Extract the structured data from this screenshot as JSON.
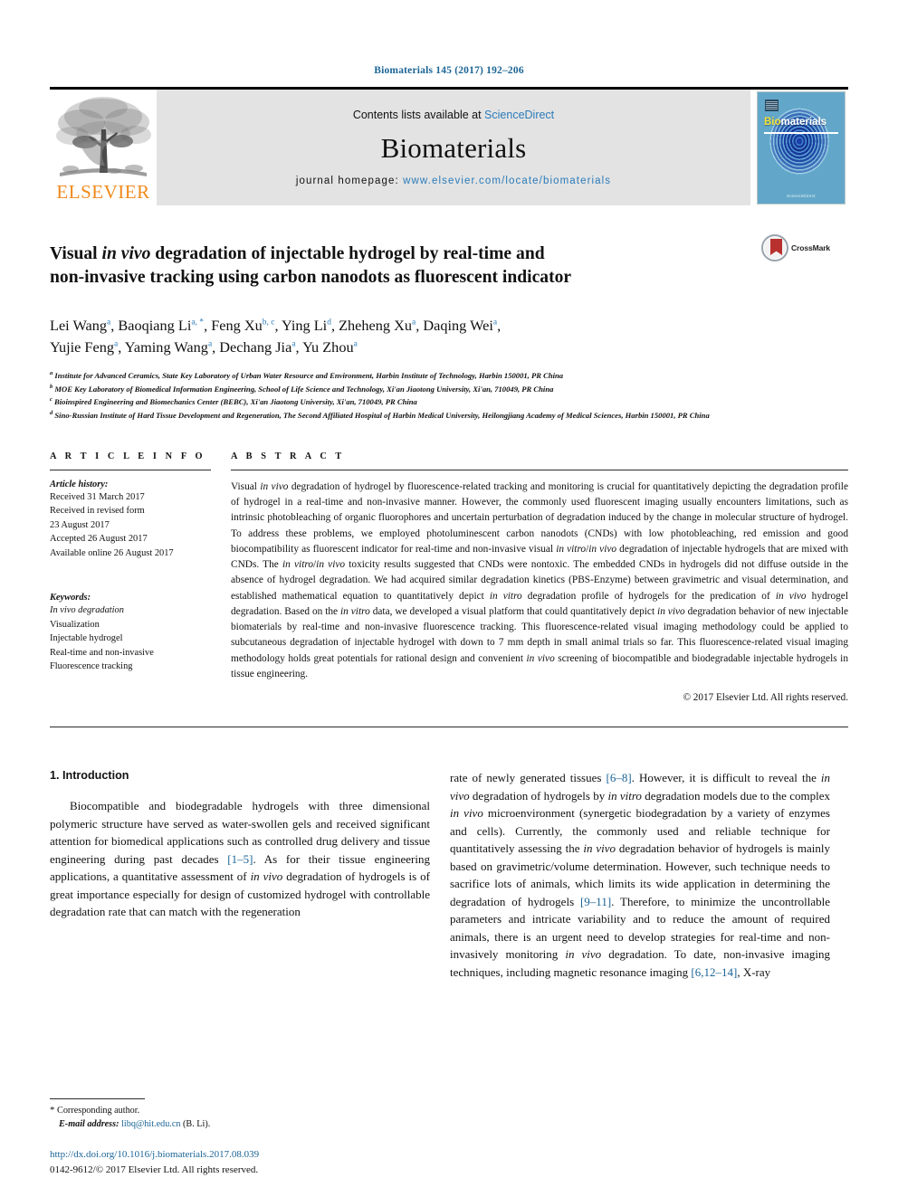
{
  "running_head": "Biomaterials 145 (2017) 192–206",
  "masthead": {
    "publisher_name": "ELSEVIER",
    "contents_prefix": "Contents lists available at ",
    "contents_link": "ScienceDirect",
    "journal_name": "Biomaterials",
    "homepage_prefix": "journal homepage: ",
    "homepage_url": "www.elsevier.com/locate/biomaterials",
    "cover_title_bio": "Bio",
    "cover_title_rest": "materials",
    "cover_footer": "ScienceDirect"
  },
  "article": {
    "title_line1_a": "Visual ",
    "title_line1_em": "in vivo",
    "title_line1_b": " degradation of injectable hydrogel by real-time and",
    "title_line2": "non-invasive tracking using carbon nanodots as fluorescent indicator",
    "crossmark_label": "CrossMark"
  },
  "authors": {
    "line1": [
      {
        "name": "Lei Wang",
        "sup": "a",
        "sep": ", "
      },
      {
        "name": "Baoqiang Li",
        "sup": "a, *",
        "sep": ", "
      },
      {
        "name": "Feng Xu",
        "sup": "b, c",
        "sep": ", "
      },
      {
        "name": "Ying Li",
        "sup": "d",
        "sep": ", "
      },
      {
        "name": "Zheheng Xu",
        "sup": "a",
        "sep": ", "
      },
      {
        "name": "Daqing Wei",
        "sup": "a",
        "sep": ","
      }
    ],
    "line2": [
      {
        "name": "Yujie Feng",
        "sup": "a",
        "sep": ", "
      },
      {
        "name": "Yaming Wang",
        "sup": "a",
        "sep": ", "
      },
      {
        "name": "Dechang Jia",
        "sup": "a",
        "sep": ", "
      },
      {
        "name": "Yu Zhou",
        "sup": "a",
        "sep": ""
      }
    ]
  },
  "affiliations": [
    {
      "marker": "a",
      "text": "Institute for Advanced Ceramics, State Key Laboratory of Urban Water Resource and Environment, Harbin Institute of Technology, Harbin 150001, PR China"
    },
    {
      "marker": "b",
      "text": "MOE Key Laboratory of Biomedical Information Engineering, School of Life Science and Technology, Xi'an Jiaotong University, Xi'an, 710049, PR China"
    },
    {
      "marker": "c",
      "text": "Bioinspired Engineering and Biomechanics Center (BEBC), Xi'an Jiaotong University, Xi'an, 710049, PR China"
    },
    {
      "marker": "d",
      "text": "Sino-Russian Institute of Hard Tissue Development and Regeneration, The Second Affiliated Hospital of Harbin Medical University, Heilongjiang Academy of Medical Sciences, Harbin 150001, PR China"
    }
  ],
  "article_info": {
    "heading": "A R T I C L E   I N F O",
    "history_label": "Article history:",
    "history_lines": [
      "Received 31 March 2017",
      "Received in revised form",
      "23 August 2017",
      "Accepted 26 August 2017",
      "Available online 26 August 2017"
    ],
    "keywords_label": "Keywords:",
    "keywords": [
      "In vivo degradation",
      "Visualization",
      "Injectable hydrogel",
      "Real-time and non-invasive",
      "Fluorescence tracking"
    ]
  },
  "abstract": {
    "heading": "A B S T R A C T",
    "paragraph_html": "Visual <em>in vivo</em> degradation of hydrogel by fluorescence-related tracking and monitoring is crucial for quantitatively depicting the degradation profile of hydrogel in a real-time and non-invasive manner. However, the commonly used fluorescent imaging usually encounters limitations, such as intrinsic photobleaching of organic fluorophores and uncertain perturbation of degradation induced by the change in molecular structure of hydrogel. To address these problems, we employed photoluminescent carbon nanodots (CNDs) with low photobleaching, red emission and good biocompatibility as fluorescent indicator for real-time and non-invasive visual <em>in vitro</em>/<em>in vivo</em> degradation of injectable hydrogels that are mixed with CNDs. The <em>in vitro</em>/<em>in vivo</em> toxicity results suggested that CNDs were nontoxic. The embedded CNDs in hydrogels did not diffuse outside in the absence of hydrogel degradation. We had acquired similar degradation kinetics (PBS-Enzyme) between gravimetric and visual determination, and established mathematical equation to quantitatively depict <em>in vitro</em> degradation profile of hydrogels for the predication of <em>in vivo</em> hydrogel degradation. Based on the <em>in vitro</em> data, we developed a visual platform that could quantitatively depict <em>in vivo</em> degradation behavior of new injectable biomaterials by real-time and non-invasive fluorescence tracking. This fluorescence-related visual imaging methodology could be applied to subcutaneous degradation of injectable hydrogel with down to 7 mm depth in small animal trials so far. This fluorescence-related visual imaging methodology holds great potentials for rational design and convenient <em>in vivo</em> screening of biocompatible and biodegradable injectable hydrogels in tissue engineering.",
    "copyright": "© 2017 Elsevier Ltd. All rights reserved."
  },
  "body": {
    "section_number_title": "1.  Introduction",
    "left_paragraph_html": "Biocompatible and biodegradable hydrogels with three dimensional polymeric structure have served as water-swollen gels and received significant attention for biomedical applications such as controlled drug delivery and tissue engineering during past decades <span class=\"ref\">[1&#8211;5]</span>. As for their tissue engineering applications, a quantitative assessment of <em>in vivo</em> degradation of hydrogels is of great importance especially for design of customized hydrogel with controllable degradation rate that can match with the regeneration",
    "right_paragraph_html": "rate of newly generated tissues <span class=\"ref\">[6&#8211;8]</span>. However, it is difficult to reveal the <em>in vivo</em> degradation of hydrogels by <em>in vitro</em> degradation models due to the complex <em>in vivo</em> microenvironment (synergetic biodegradation by a variety of enzymes and cells). Currently, the commonly used and reliable technique for quantitatively assessing the <em>in vivo</em> degradation behavior of hydrogels is mainly based on gravimetric/volume determination. However, such technique needs to sacrifice lots of animals, which limits its wide application in determining the degradation of hydrogels <span class=\"ref\">[9&#8211;11]</span>. Therefore, to minimize the uncontrollable parameters and intricate variability and to reduce the amount of required animals, there is an urgent need to develop strategies for real-time and non-invasively monitoring <em>in vivo</em> degradation. To date, non-invasive imaging techniques, including magnetic resonance imaging <span class=\"ref\">[6,12&#8211;14]</span>, X-ray"
  },
  "footnote": {
    "corresponding_marker": "*",
    "corresponding_text": " Corresponding author.",
    "email_label": "E-mail address:",
    "email": "libq@hit.edu.cn",
    "email_suffix": " (B. Li)."
  },
  "doi": {
    "url": "http://dx.doi.org/10.1016/j.biomaterials.2017.08.039",
    "issn_line": "0142-9612/© 2017 Elsevier Ltd. All rights reserved."
  },
  "colors": {
    "link_blue": "#1a6496",
    "sd_blue": "#2b7bb9",
    "elsevier_orange": "#F08A1D",
    "crossmark_red": "#b8312f",
    "band_gray": "#e3e3e3"
  }
}
